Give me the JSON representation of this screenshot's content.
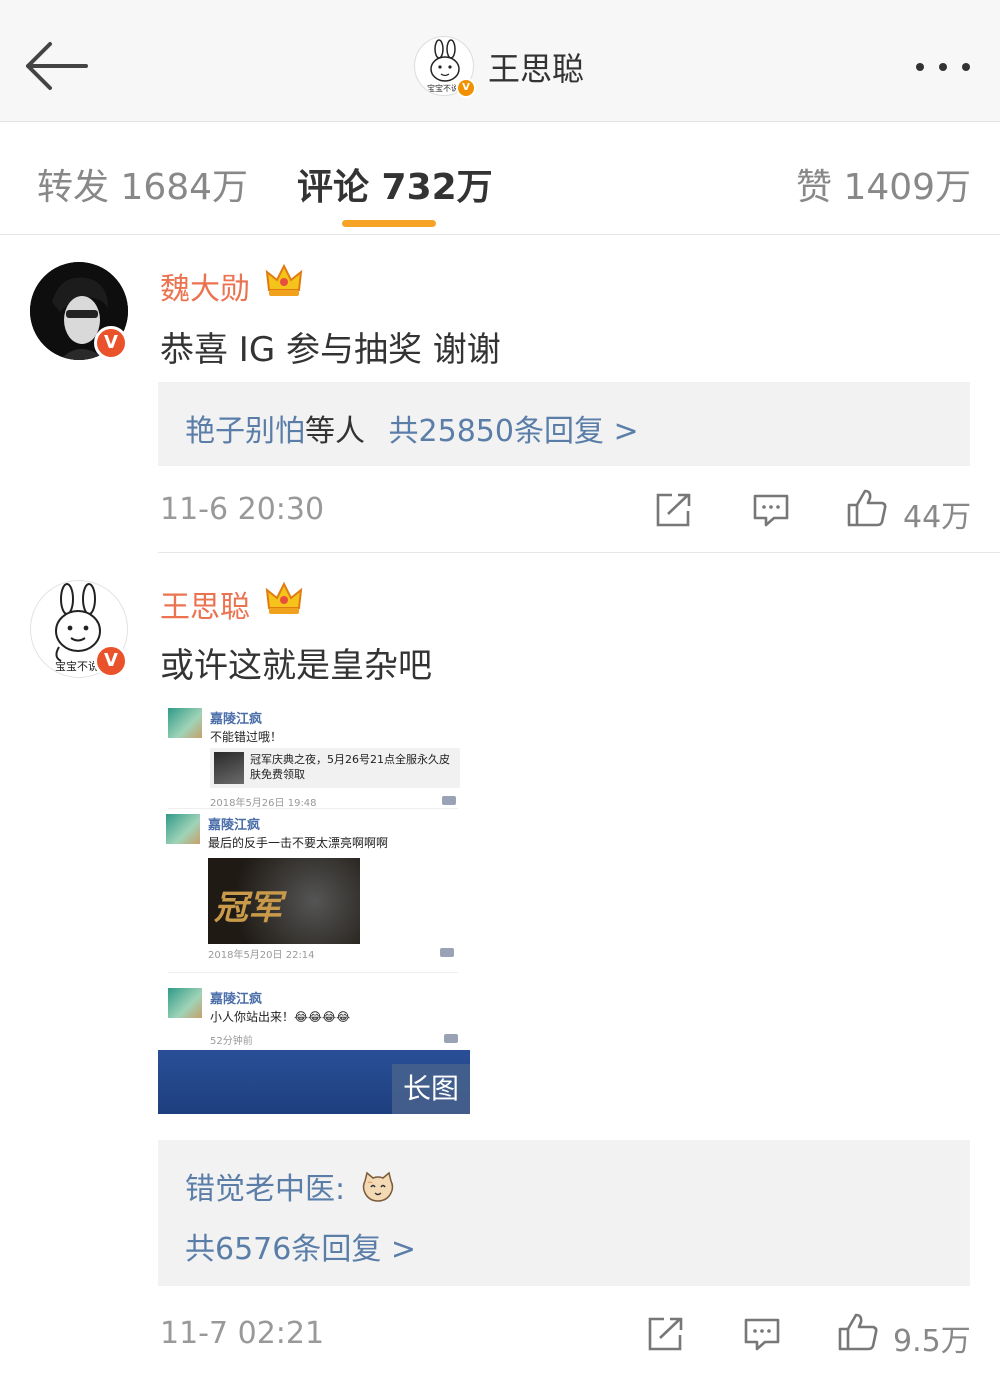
{
  "header": {
    "title": "王思聪",
    "avatar_caption": "宝宝不说",
    "verified_mark": "V"
  },
  "tabs": [
    {
      "label": "转发 1684万"
    },
    {
      "label": "评论 732万"
    },
    {
      "label": "赞 1409万"
    }
  ],
  "comments": [
    {
      "username": "魏大勋",
      "verified_mark": "V",
      "text": "恭喜 IG 参与抽奖 谢谢",
      "reply_names": "艳子别怕",
      "reply_mid": "等人",
      "reply_count": "共25850条回复 >",
      "time": "11-6 20:30",
      "likes": "44万"
    },
    {
      "username": "王思聪",
      "avatar_caption": "宝宝不说",
      "verified_mark": "V",
      "text": "或许这就是皇杂吧",
      "long_image": {
        "badge": "长图",
        "messages": [
          {
            "sender": "嘉陵江疯",
            "text": "不能错过哦！",
            "card_text": "冠军庆典之夜，5月26号21点全服永久皮肤免费领取",
            "time": "2018年5月26日 19:48"
          },
          {
            "sender": "嘉陵江疯",
            "text": "最后的反手一击不要太漂亮啊啊啊",
            "poster_text": "冠军",
            "time": "2018年5月20日 22:14"
          },
          {
            "sender": "嘉陵江疯",
            "text": "小人你站出来！😂😂😂😂",
            "time": "52分钟前"
          }
        ]
      },
      "reply_preview_name": "错觉老中医:",
      "reply_count": "共6576条回复 >",
      "time": "11-7 02:21",
      "likes": "9.5万"
    }
  ],
  "colors": {
    "username": "#eb7350",
    "link": "#5b7ea9",
    "tab_indicator": "#f7a326",
    "verified": "#e9522b"
  }
}
